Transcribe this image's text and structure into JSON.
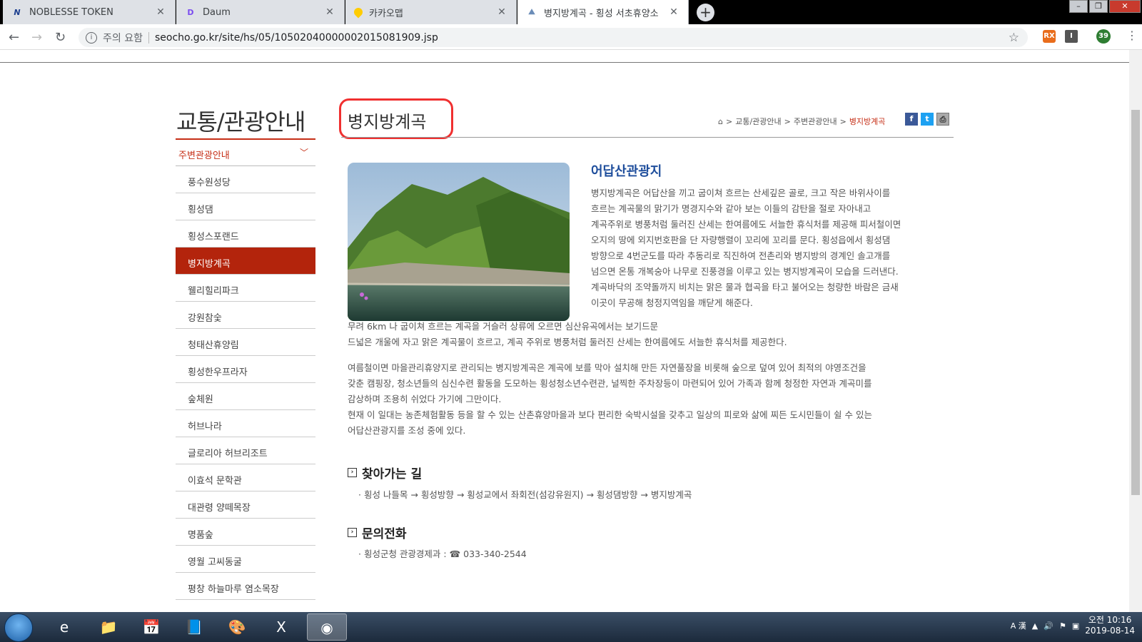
{
  "browser": {
    "tabs": [
      {
        "title": "NOBLESSE TOKEN",
        "icon": "noblesse-icon"
      },
      {
        "title": "Daum",
        "icon": "daum-icon"
      },
      {
        "title": "카카오맵",
        "icon": "kakaomap-icon"
      },
      {
        "title": "병지방계곡 - 횡성 서초휴양소",
        "icon": "site-icon"
      }
    ],
    "security_label": "주의 요함",
    "url": "seocho.go.kr/site/hs/05/10502040000002015081909.jsp",
    "profile_badge": "39"
  },
  "sidebar": {
    "title": "교통/관광안내",
    "section": "주변관광안내",
    "items": [
      "풍수원성당",
      "횡성댐",
      "횡성스포랜드",
      "병지방계곡",
      "웰리힐리파크",
      "강원참숯",
      "청태산휴양림",
      "횡성한우프라자",
      "숲체원",
      "허브나라",
      "글로리아 허브리조트",
      "이효석 문학관",
      "대관령 양떼목장",
      "명품숲",
      "영월 고씨동굴",
      "평창 하늘마루 염소목장"
    ],
    "active_index": 3
  },
  "content": {
    "title": "병지방계곡",
    "breadcrumb": [
      "교통/관광안내",
      "주변관광안내",
      "병지방계곡"
    ],
    "subtitle": "어답산관광지",
    "intro_lines": [
      "병지방계곡은 어답산을 끼고 굽이쳐 흐르는 산세깊은 골로, 크고 작은 바위사이를",
      "흐르는 계곡물의 맑기가 명경지수와 같아 보는 이들의 감탄을 절로 자아내고",
      "계곡주위로 병풍처럼 둘러진 산세는 한여름에도 서늘한 휴식처를 제공해 피서철이면",
      "오지의 땅에 외지번호판을 단 자량행렬이 꼬리에 꼬리를 문다. 횡성읍에서 횡성댐",
      "방향으로 4번군도를 따라 추동리로 직진하여 전촌리와 병지방의 경계인 솔고개를",
      "넘으면 온통 개복숭아 나무로 진풍경을 이루고 있는 병지방계곡이 모습을 드러낸다.",
      "계곡바닥의 조약돌까지 비치는 맑은 물과 협곡을 타고 불어오는 청량한 바람은 금새",
      "이곳이 무공해 청정지역임을 깨닫게 해준다."
    ],
    "para2_lines": [
      "무려 6km 나 굽이쳐 흐르는 계곡을 거슬러 상류에 오르면 심산유곡에서는 보기드문",
      "드넓은 개울에 자고 맑은 계곡물이 흐르고, 계곡 주위로 병풍처럼 둘러진 산세는 한여름에도 서늘한 휴식처를 제공한다."
    ],
    "para3_lines": [
      "여름철이면 마을관리휴양지로 관리되는 병지방계곡은 계곡에 보를 막아 설치해 만든 자연풀장을 비롯해 숲으로 덮여 있어 최적의 야영조건을",
      "갖춘 캠핑장, 청소년들의 심신수련 활동을 도모하는 횡성청소년수련관, 널찍한 주차장등이 마련되어 있어 가족과 함께 청정한 자연과 계곡미를",
      "감상하며 조용히 쉬었다 가기에 그만이다.",
      "현재 이 일대는 농존체험활동 등을 할 수 있는 산촌휴양마을과 보다 편리한 숙박시설을 갖추고 일상의 피로와 삶에 찌든 도시민들이 쉴 수 있는",
      "어답산관광지를 조성 중에 있다."
    ],
    "directions_title": "찾아가는 길",
    "directions": "· 횡성 나들목 → 횡성방향 → 횡성교에서 좌회전(섬강유원지) → 횡성댐방향 → 병지방계곡",
    "contact_title": "문의전화",
    "contact": "· 횡성군청 관광경제과 : ☎ 033-340-2544"
  },
  "taskbar": {
    "clock_ampm": "오전 10:16",
    "date": "2019-08-14",
    "ime": "A 漢"
  },
  "colors": {
    "accent_red": "#b3240c",
    "subtitle_blue": "#1f4e9c"
  }
}
